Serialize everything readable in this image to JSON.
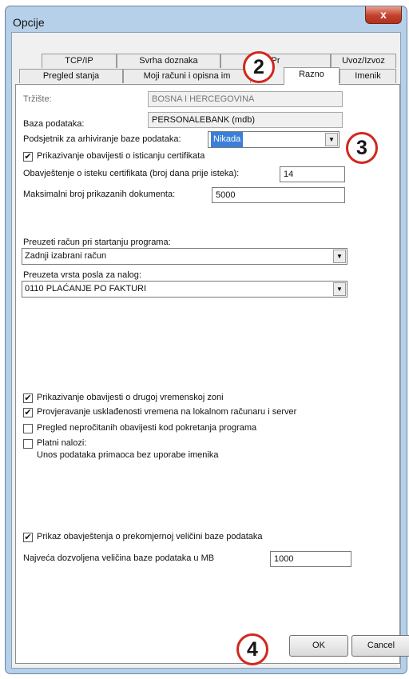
{
  "window": {
    "title": "Opcije",
    "close_glyph": "x"
  },
  "tabs": {
    "row1": [
      "TCP/IP",
      "Svrha doznaka",
      "Pr",
      "Uvoz/Izvoz"
    ],
    "row2": [
      "Pregled stanja",
      "Moji računi i opisna im",
      "Razno",
      "Imenik"
    ]
  },
  "form": {
    "trziste": {
      "label": "Tržište:",
      "value": "BOSNA I HERCEGOVINA"
    },
    "baza": {
      "label": "Baza podataka:",
      "value": "PERSONALEBANK (mdb)"
    },
    "podsjetnik": {
      "label": "Podsjetnik za arhiviranje baze podataka:",
      "value": "Nikada"
    },
    "prikazivanje_cert": {
      "label": "Prikazivanje obavijesti o isticanju certifikata",
      "checked": true
    },
    "obavjestenje_cert": {
      "label": "Obavještenje o isteku certifikata (broj dana prije isteka):",
      "value": "14"
    },
    "max_dokumenata": {
      "label": "Maksimalni broj prikazanih dokumenta:",
      "value": "5000"
    },
    "preuzeti_racun": {
      "label": "Preuzeti račun pri startanju programa:",
      "value": "Zadnji izabrani račun"
    },
    "vrsta_posla": {
      "label": "Preuzeta vrsta posla za nalog:",
      "value": "0110  PLAĆANJE PO FAKTURI"
    },
    "checks": [
      {
        "label": "Prikazivanje obavijesti o drugoj vremenskoj zoni",
        "checked": true
      },
      {
        "label": "Provjeravanje usklađenosti vremena na lokalnom računaru i server",
        "checked": true
      },
      {
        "label": "Pregled nepročitanih obavijesti kod pokretanja programa",
        "checked": false
      },
      {
        "label": "Platni nalozi:",
        "sublabel": "Unos podataka primaoca bez uporabe imenika",
        "checked": false
      }
    ],
    "prikaz_velicina": {
      "label": "Prikaz obavještenja o prekomjernoj veličini baze podataka",
      "checked": true
    },
    "max_velicina": {
      "label": "Najveća dozvoljena veličina baze podataka u  MB",
      "value": "1000"
    }
  },
  "buttons": {
    "ok": "OK",
    "cancel": "Cancel"
  },
  "callouts": [
    "2",
    "3",
    "4"
  ],
  "icons": {
    "checkmark": "✔",
    "dropdown": "▼"
  },
  "colors": {
    "callout_ring": "#d1271d",
    "selection": "#3a7fd8",
    "close_button": "#c2412c"
  }
}
